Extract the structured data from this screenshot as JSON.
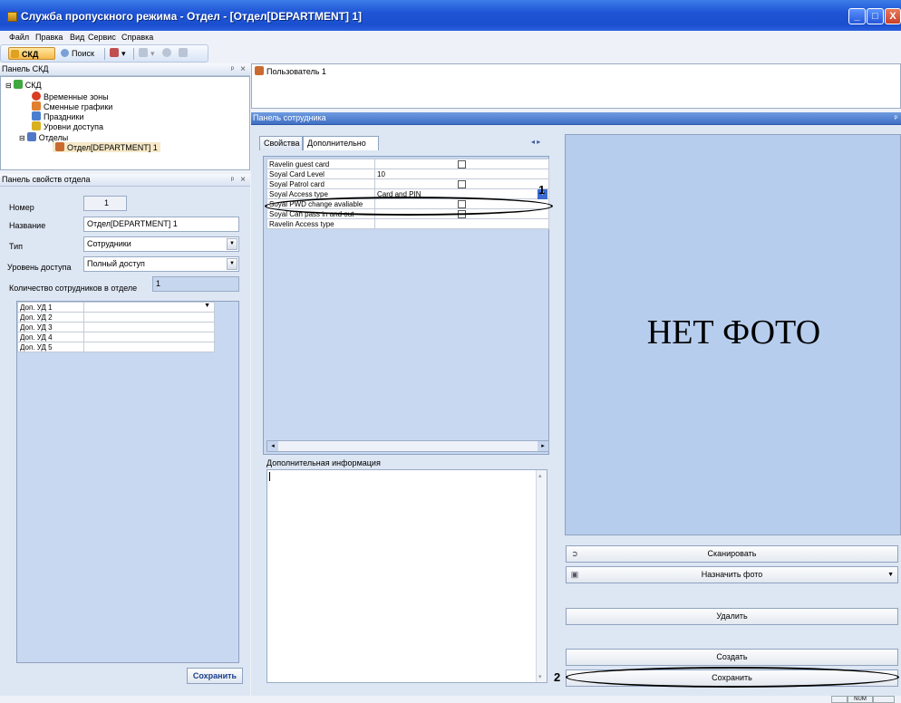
{
  "window": {
    "title": "Служба пропускного режима - Отдел - [Отдел[DEPARTMENT] 1]",
    "buttons": {
      "minimize": "_",
      "maximize": "□",
      "close": "X"
    }
  },
  "menu": [
    "Файл",
    "Правка",
    "Вид",
    "Сервис",
    "Справка"
  ],
  "toolbar": {
    "skd": "СКД",
    "search": "Поиск"
  },
  "skd_panel": {
    "title": "Панель СКД",
    "pin": "ᵖ",
    "close": "×",
    "tree": [
      {
        "label": "СКД",
        "icon": "skd-icon"
      },
      {
        "label": "Временные зоны",
        "icon": "clock-icon"
      },
      {
        "label": "Сменные графики",
        "icon": "shift-icon"
      },
      {
        "label": "Праздники",
        "icon": "calendar-icon"
      },
      {
        "label": "Уровни доступа",
        "icon": "key-icon"
      },
      {
        "label": "Отделы",
        "icon": "group-icon"
      },
      {
        "label": "Отдел[DEPARTMENT] 1",
        "icon": "department-icon"
      }
    ]
  },
  "user_tab": {
    "label": "Пользователь 1"
  },
  "dept_panel": {
    "title": "Панель свойств отдела",
    "number_label": "Номер",
    "number_value": "1",
    "name_label": "Название",
    "name_value": "Отдел[DEPARTMENT] 1",
    "type_label": "Тип",
    "type_value": "Сотрудники",
    "level_label": "Уровень доступа",
    "level_value": "Полный доступ",
    "count_label": "Количество сотрудников в отделе",
    "count_value": "1",
    "extra_rows": [
      "Доп. УД 1",
      "Доп. УД 2",
      "Доп. УД 3",
      "Доп. УД 4",
      "Доп. УД 5"
    ],
    "save": "Сохранить"
  },
  "employee_panel": {
    "title": "Панель сотрудника",
    "tabs": [
      "Свойства",
      "Дополнительно"
    ],
    "properties": [
      {
        "name": "Ravelin guest card",
        "value": "",
        "kind": "checkbox"
      },
      {
        "name": "Soyal Card Level",
        "value": "10",
        "kind": "text"
      },
      {
        "name": "Soyal Patrol card",
        "value": "",
        "kind": "checkbox"
      },
      {
        "name": "Soyal Access type",
        "value": "Card and PIN",
        "kind": "dropdown"
      },
      {
        "name": "Soyal PWD change avaliable",
        "value": "",
        "kind": "checkbox"
      },
      {
        "name": "Soyal Can pass in and out",
        "value": "",
        "kind": "checkbox"
      },
      {
        "name": "Ravelin Access type",
        "value": "",
        "kind": "text"
      }
    ],
    "extra_info_label": "Дополнительная информация",
    "no_photo": "НЕТ ФОТО",
    "buttons": {
      "scan": "Сканировать",
      "assign_photo": "Назначить фото",
      "delete": "Удалить",
      "create": "Создать",
      "save": "Сохранить"
    }
  },
  "callouts": {
    "one": "1",
    "two": "2"
  },
  "status": {
    "num": "NUM"
  }
}
